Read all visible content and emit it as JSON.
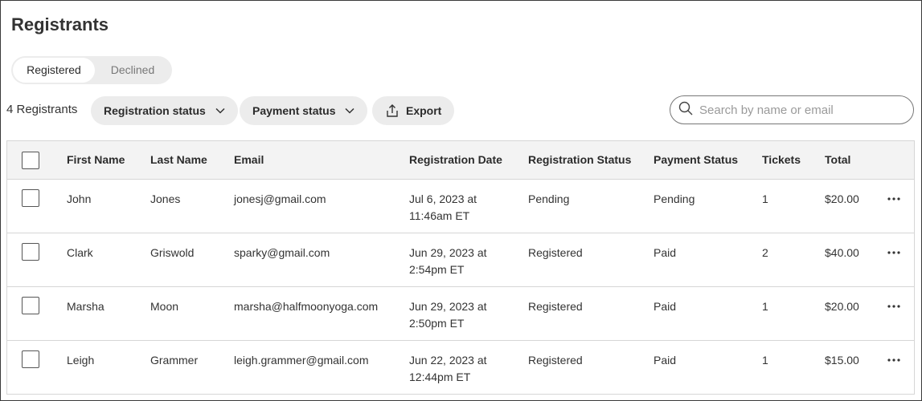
{
  "page": {
    "title": "Registrants"
  },
  "tabs": [
    {
      "label": "Registered",
      "active": true
    },
    {
      "label": "Declined",
      "active": false
    }
  ],
  "toolbar": {
    "count_label": "4 Registrants",
    "registration_status_label": "Registration status",
    "payment_status_label": "Payment status",
    "export_label": "Export",
    "search_placeholder": "Search by name or email"
  },
  "table": {
    "columns": {
      "first_name": "First Name",
      "last_name": "Last Name",
      "email": "Email",
      "registration_date": "Registration Date",
      "registration_status": "Registration Status",
      "payment_status": "Payment Status",
      "tickets": "Tickets",
      "total": "Total"
    },
    "rows": [
      {
        "first": "John",
        "last": "Jones",
        "email": "jonesj@gmail.com",
        "date_line1": "Jul 6, 2023 at",
        "date_line2": "11:46am ET",
        "reg_status": "Pending",
        "pay_status": "Pending",
        "tickets": "1",
        "total": "$20.00"
      },
      {
        "first": "Clark",
        "last": "Griswold",
        "email": "sparky@gmail.com",
        "date_line1": "Jun 29, 2023 at",
        "date_line2": "2:54pm ET",
        "reg_status": "Registered",
        "pay_status": "Paid",
        "tickets": "2",
        "total": "$40.00"
      },
      {
        "first": "Marsha",
        "last": "Moon",
        "email": "marsha@halfmoonyoga.com",
        "date_line1": "Jun 29, 2023 at",
        "date_line2": "2:50pm ET",
        "reg_status": "Registered",
        "pay_status": "Paid",
        "tickets": "1",
        "total": "$20.00"
      },
      {
        "first": "Leigh",
        "last": "Grammer",
        "email": "leigh.grammer@gmail.com",
        "date_line1": "Jun 22, 2023 at",
        "date_line2": "12:44pm ET",
        "reg_status": "Registered",
        "pay_status": "Paid",
        "tickets": "1",
        "total": "$15.00"
      }
    ]
  },
  "icons": {
    "chevron": "chevron-down-icon",
    "export": "export-icon",
    "search": "search-icon",
    "more": "more-horizontal-icon"
  }
}
